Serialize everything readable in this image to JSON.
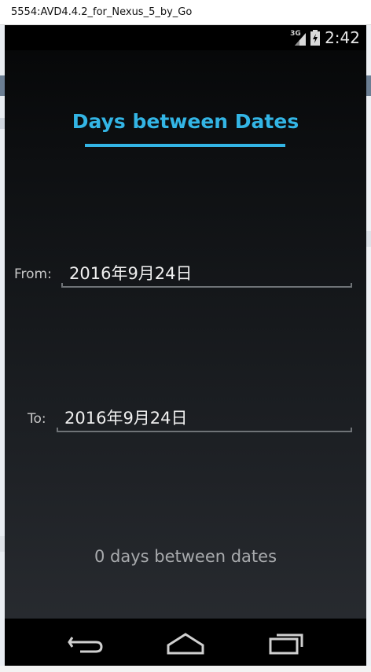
{
  "window": {
    "title": "5554:AVD4.4.2_for_Nexus_5_by_Go"
  },
  "statusbar": {
    "network": "3G",
    "time": "2:42",
    "icons": [
      "signal-icon",
      "battery-icon"
    ]
  },
  "app": {
    "title": "Days between Dates",
    "from": {
      "label": "From:",
      "value": "2016年9月24日"
    },
    "to": {
      "label": "To:",
      "value": "2016年9月24日"
    },
    "result": "0 days between dates",
    "accent_color": "#33b5e5"
  },
  "navbar": {
    "buttons": [
      "back-icon",
      "home-icon",
      "recents-icon"
    ]
  }
}
